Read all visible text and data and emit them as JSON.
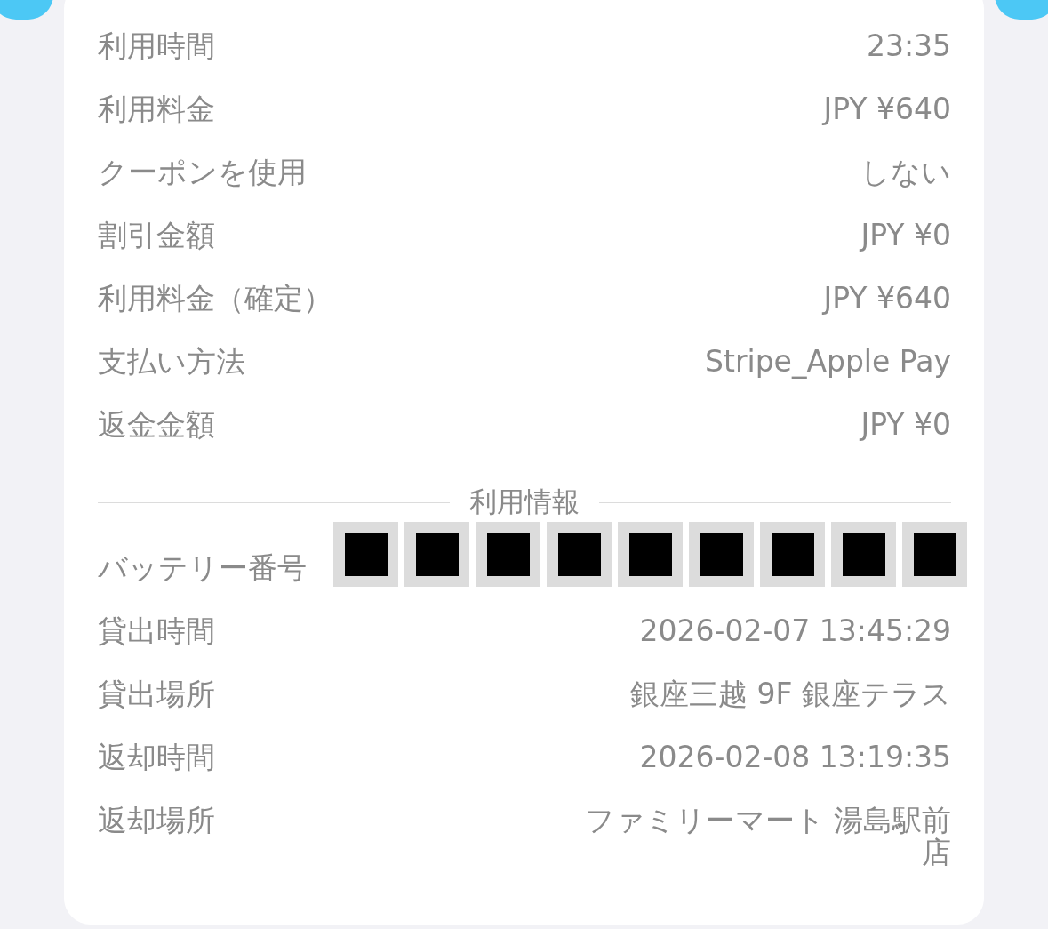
{
  "payment_rows": [
    {
      "label": "利用時間",
      "value": "23:35"
    },
    {
      "label": "利用料金",
      "value": "JPY ¥640"
    },
    {
      "label": "クーポンを使用",
      "value": "しない"
    },
    {
      "label": "割引金額",
      "value": "JPY ¥0"
    },
    {
      "label": "利用料金（確定）",
      "value": "JPY ¥640"
    },
    {
      "label": "支払い方法",
      "value": "Stripe_Apple Pay"
    },
    {
      "label": "返金金額",
      "value": "JPY ¥0"
    }
  ],
  "section_title": "利用情報",
  "usage_rows": [
    {
      "label": "バッテリー番号",
      "redacted": true
    },
    {
      "label": "貸出時間",
      "value": "2026-02-07 13:45:29",
      "redacted": false
    },
    {
      "label": "貸出場所",
      "value": "銀座三越 9F 銀座テラス",
      "redacted": false
    },
    {
      "label": "返却時間",
      "value": "2026-02-08 13:19:35",
      "redacted": false
    },
    {
      "label": "返却場所",
      "value": "ファミリーマート 湯島駅前店",
      "redacted": false
    }
  ]
}
